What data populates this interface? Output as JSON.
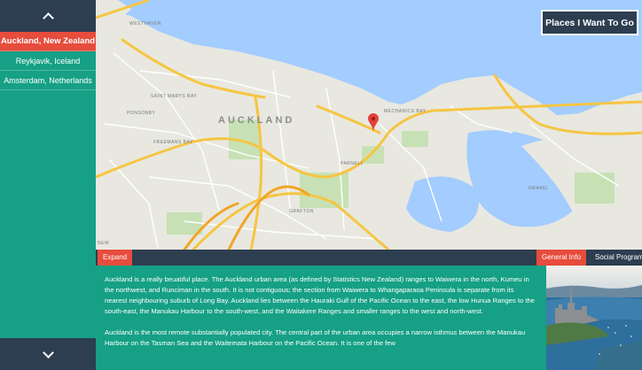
{
  "sidebar": {
    "places": [
      {
        "label": "Auckland, New Zealand",
        "active": true
      },
      {
        "label": "Reykjavik, Iceland",
        "active": false
      },
      {
        "label": "Amsterdam, Netherlands",
        "active": false
      }
    ]
  },
  "map": {
    "title_box": "Places I Want To Go",
    "city_label": "AUCKLAND",
    "labels": {
      "westhaven": "WESTHAVEN",
      "saint_marys_bay": "SAINT MARYS BAY",
      "ponsonby": "PONSONBY",
      "freemans_bay": "FREEMANS BAY",
      "mechanics_bay": "MECHANICS BAY",
      "parnell": "PARNELL",
      "grafton": "GRAFTON",
      "orakei": "ORAKEI",
      "newton": "NEW"
    }
  },
  "toolbar": {
    "expand_label": "Expand",
    "tab_general": "General Info",
    "tab_social": "Social Programs"
  },
  "content": {
    "paragraphs": [
      "Auckland is a really beuatiful place. The Auckland urban area (as defined by Statistics New Zealand) ranges to Waiwera in the north, Kumeu in the northwest, and Runciman in the south. It is not contiguous; the section from Waiwera to Whangaparaoa Peninsula is separate from its nearest neighbouring suburb of Long Bay. Auckland lies between the Hauraki Gulf of the Pacific Ocean to the east, the low Hunua Ranges to the south-east, the Manukau Harbour to the south-west, and the Waitakere Ranges and smaller ranges to the west and north-west.",
      "Auckland is the most remote substantially populated city. The central part of the urban area occupies a narrow isthmus between the Manukau Harbour on the Tasman Sea and the Waitemata Harbour on the Pacific Ocean. It is one of the few"
    ]
  },
  "colors": {
    "sidebar": "#16a085",
    "navy": "#2c3e50",
    "accent_red": "#e74c3c",
    "water": "#a3ccff",
    "land": "#e8e8e0",
    "road_major": "#f6c542"
  },
  "icons": {
    "up": "chevron-up-icon",
    "down": "chevron-down-icon",
    "pin": "map-pin-icon"
  }
}
